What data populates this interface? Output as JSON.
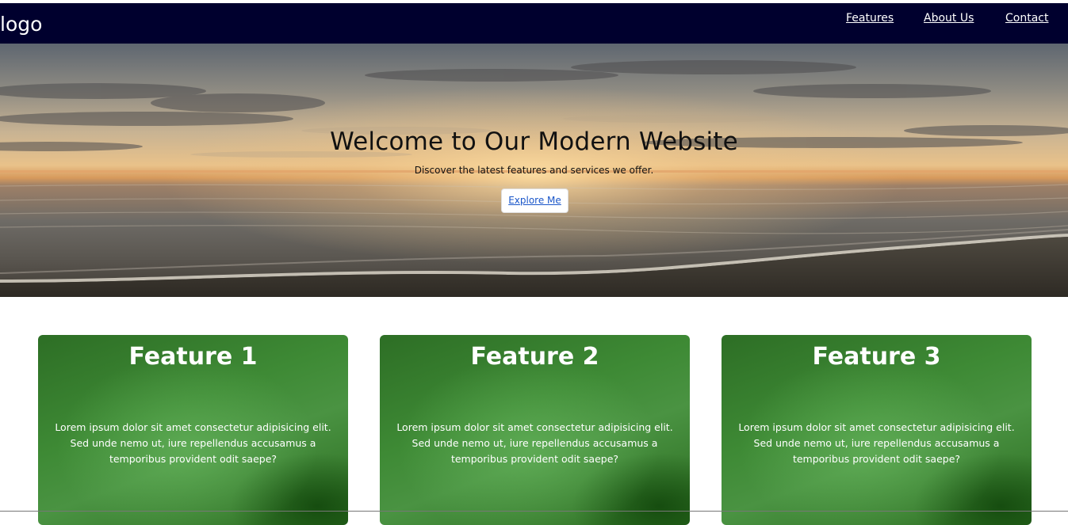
{
  "nav": {
    "logo": "logo",
    "links": [
      "Features",
      "About Us",
      "Contact"
    ]
  },
  "hero": {
    "title": "Welcome to Our Modern Website",
    "subtitle": "Discover the latest features and services we offer.",
    "button": "Explore Me"
  },
  "features": [
    {
      "title": "Feature 1",
      "text": "Lorem ipsum dolor sit amet consectetur adipisicing elit. Sed unde nemo ut, iure repellendus accusamus a temporibus provident odit saepe?"
    },
    {
      "title": "Feature 2",
      "text": "Lorem ipsum dolor sit amet consectetur adipisicing elit. Sed unde nemo ut, iure repellendus accusamus a temporibus provident odit saepe?"
    },
    {
      "title": "Feature 3",
      "text": "Lorem ipsum dolor sit amet consectetur adipisicing elit. Sed unde nemo ut, iure repellendus accusamus a temporibus provident odit saepe?"
    }
  ],
  "colors": {
    "navbar": "#00002e",
    "card": "#3e8a35",
    "link": "#1a56c9"
  }
}
